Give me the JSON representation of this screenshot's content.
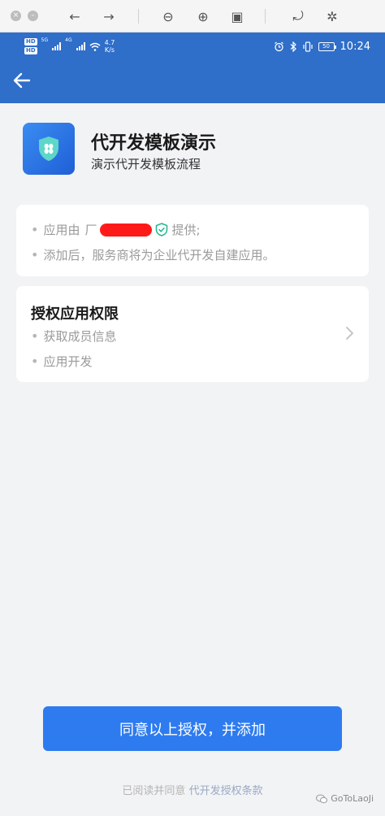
{
  "viewer": {
    "close_glyph": "×",
    "min_glyph": "–",
    "back_glyph": "←",
    "forward_glyph": "→",
    "zoom_out_glyph": "⊖",
    "zoom_in_glyph": "⊕",
    "fit_glyph": "▣",
    "rotate_glyph": "⤾",
    "magic_glyph": "✲"
  },
  "status_bar": {
    "hd1": "HD",
    "hd2": "HD",
    "sig1": "5G",
    "sig2": "4G",
    "net_speed_value": "4.7",
    "net_speed_unit": "K/s",
    "battery": "50",
    "time": "10:24"
  },
  "app": {
    "title": "代开发模板演示",
    "subtitle": "演示代开发模板流程"
  },
  "info_card": {
    "line1_prefix": "应用由",
    "line1_mid": "厂",
    "line1_suffix": "提供;",
    "line2": "添加后，服务商将为企业代开发自建应用。"
  },
  "permissions": {
    "title": "授权应用权限",
    "items": [
      "获取成员信息",
      "应用开发"
    ]
  },
  "actions": {
    "agree_button": "同意以上授权，并添加",
    "terms_prefix": "已阅读并同意",
    "terms_link": "代开发授权条款"
  },
  "watermark": {
    "text": "GoToLaoJi"
  },
  "colors": {
    "header": "#2f6ec9",
    "primary": "#2e7bf0",
    "verified": "#1fb58f"
  }
}
